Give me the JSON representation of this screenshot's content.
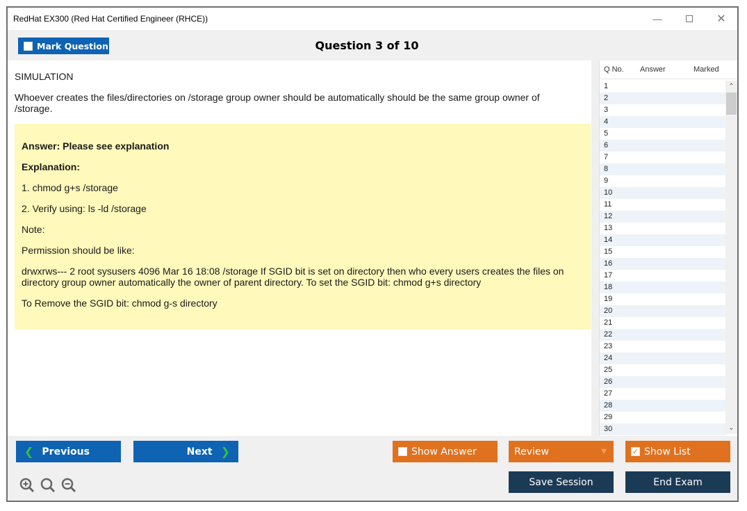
{
  "window": {
    "title": "RedHat EX300 (Red Hat Certified Engineer (RHCE))",
    "controls": [
      "minimize-icon",
      "maximize-icon",
      "close-icon"
    ]
  },
  "toolbar": {
    "mark_question_label": "Mark Question",
    "mark_question_checked": false,
    "question_title": "Question 3 of 10"
  },
  "question": {
    "type": "SIMULATION",
    "text": "Whoever creates the files/directories on /storage group owner should be automatically should be the same group owner of /storage."
  },
  "answer": {
    "answer_line": "Answer: Please see explanation",
    "explanation_label": "Explanation:",
    "lines": [
      "1. chmod g+s /storage",
      "2. Verify using: ls -ld /storage",
      "Note:",
      "Permission should be like:",
      "drwxrws--- 2 root sysusers 4096 Mar 16 18:08 /storage If SGID bit is set on directory then who every users creates the files on directory group owner automatically the owner of parent directory. To set the SGID bit: chmod g+s directory",
      "To Remove the SGID bit: chmod g-s directory"
    ]
  },
  "question_list": {
    "headers": [
      "Q No.",
      "Answer",
      "Marked"
    ],
    "rows": [
      "1",
      "2",
      "3",
      "4",
      "5",
      "6",
      "7",
      "8",
      "9",
      "10",
      "11",
      "12",
      "13",
      "14",
      "15",
      "16",
      "17",
      "18",
      "19",
      "20",
      "21",
      "22",
      "23",
      "24",
      "25",
      "26",
      "27",
      "28",
      "29",
      "30"
    ]
  },
  "footer": {
    "previous_label": "Previous",
    "next_label": "Next",
    "show_answer_label": "Show Answer",
    "show_answer_checked": false,
    "review_label": "Review",
    "show_list_label": "Show List",
    "show_list_checked": true,
    "save_session_label": "Save Session",
    "end_exam_label": "End Exam",
    "zoom_icons": [
      "zoom-in-icon",
      "zoom-reset-icon",
      "zoom-out-icon"
    ]
  },
  "colors": {
    "primary_blue": "#0e63b3",
    "orange": "#e0711f",
    "navy": "#1b3a55",
    "answer_bg": "#fff9bb",
    "chevron_green": "#35c23a"
  }
}
